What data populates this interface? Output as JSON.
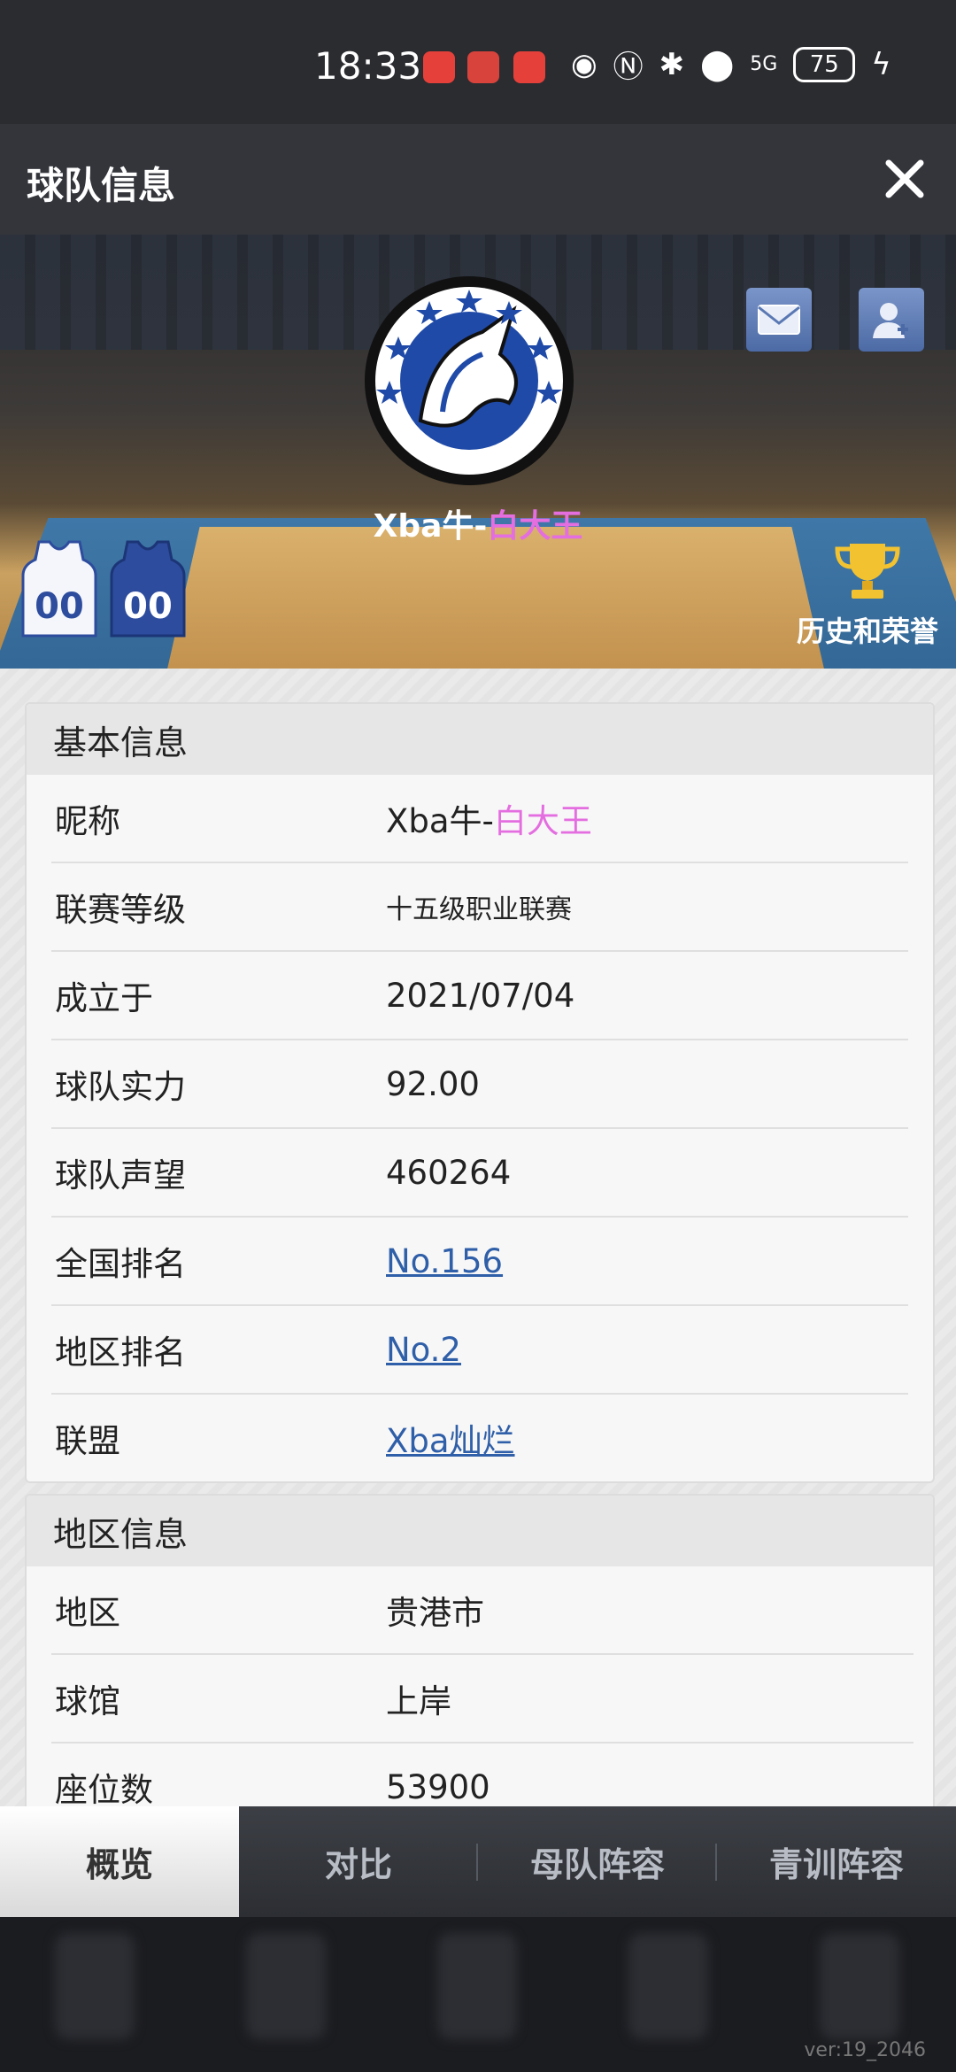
{
  "status_bar": {
    "time": "18:33",
    "battery": "75",
    "network": "5G"
  },
  "header": {
    "title": "球队信息"
  },
  "hero": {
    "team_name_prefix": "Xba牛-",
    "team_name_suffix": "白大王",
    "jersey_number_home": "00",
    "jersey_number_away": "00",
    "honor_label": "历史和荣誉"
  },
  "basic_info": {
    "title": "基本信息",
    "rows": [
      {
        "label": "昵称",
        "value_prefix": "Xba牛-",
        "value_suffix": "白大王"
      },
      {
        "label": "联赛等级",
        "value": "十五级职业联赛"
      },
      {
        "label": "成立于",
        "value": "2021/07/04"
      },
      {
        "label": "球队实力",
        "value": "92.00"
      },
      {
        "label": "球队声望",
        "value": "460264"
      },
      {
        "label": "全国排名",
        "value": "No.156"
      },
      {
        "label": "地区排名",
        "value": "No.2"
      },
      {
        "label": "联盟",
        "value": "Xba灿烂"
      }
    ]
  },
  "region_info": {
    "title": "地区信息",
    "rows": [
      {
        "label": "地区",
        "value": "贵港市"
      },
      {
        "label": "球馆",
        "value": "上岸"
      },
      {
        "label": "座位数",
        "value": "53900"
      }
    ]
  },
  "tabs": [
    {
      "label": "概览",
      "active": true
    },
    {
      "label": "对比",
      "active": false
    },
    {
      "label": "母队阵容",
      "active": false
    },
    {
      "label": "青训阵容",
      "active": false
    }
  ],
  "version": "ver:19_2046",
  "colors": {
    "accent_pink": "#e46ee0",
    "link_blue": "#2f5fa8",
    "header_bg": "#33353b"
  },
  "icons": [
    "close-icon",
    "mail-icon",
    "add-friend-icon",
    "trophy-icon",
    "jersey-icon",
    "team-logo"
  ]
}
